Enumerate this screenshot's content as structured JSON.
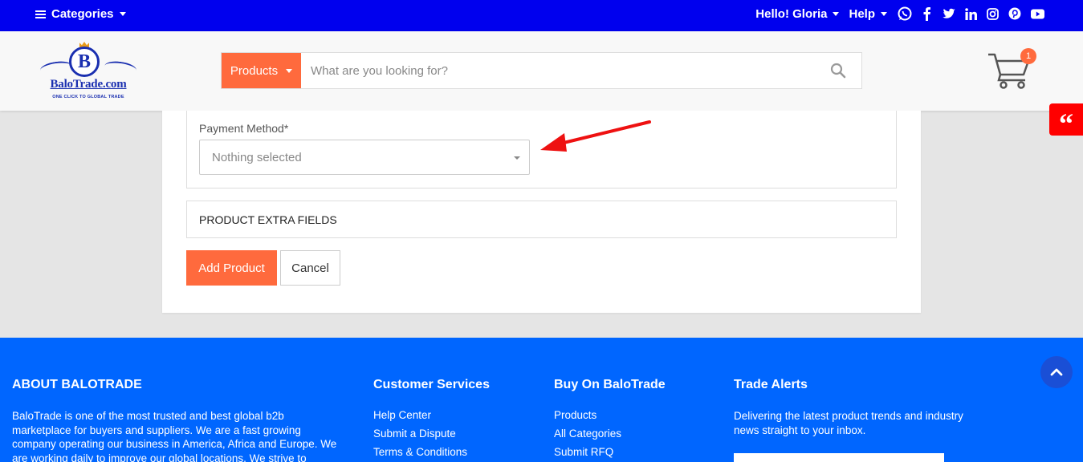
{
  "topbar": {
    "categories_label": "Categories",
    "greeting": "Hello! Gloria",
    "help_label": "Help",
    "social_icons": [
      "whatsapp-icon",
      "facebook-icon",
      "twitter-icon",
      "linkedin-icon",
      "instagram-icon",
      "pinterest-icon",
      "youtube-icon"
    ]
  },
  "header": {
    "logo_text": "BaloTrade.com",
    "logo_letter": "B",
    "logo_tagline": "ONE CLICK TO GLOBAL TRADE",
    "search_category": "Products",
    "search_placeholder": "What are you looking for?",
    "cart_count": "1",
    "quote_glyph": "“"
  },
  "form": {
    "payment_label": "Payment Method*",
    "payment_value": "Nothing selected",
    "extra_fields_label": "PRODUCT EXTRA FIELDS",
    "add_button": "Add Product",
    "cancel_button": "Cancel"
  },
  "footer": {
    "about": {
      "title": "ABOUT BALOTRADE",
      "text": "BaloTrade is one of the most trusted and best global b2b marketplace for buyers and suppliers. We are a fast growing company operating our business in America, Africa and Europe. We are working daily to improve our global locations. We strive to"
    },
    "customer_services": {
      "title": "Customer Services",
      "links": [
        "Help Center",
        "Submit a Dispute",
        "Terms & Conditions"
      ]
    },
    "buy_on": {
      "title": "Buy On BaloTrade",
      "links": [
        "Products",
        "All Categories",
        "Submit RFQ"
      ]
    },
    "trade_alerts": {
      "title": "Trade Alerts",
      "text": "Delivering the latest product trends and industry news straight to your inbox."
    }
  },
  "colors": {
    "topbar": "#0000ee",
    "accent": "#ff6a3d",
    "footer": "#0066ff",
    "annotation_arrow": "#ee1111"
  }
}
